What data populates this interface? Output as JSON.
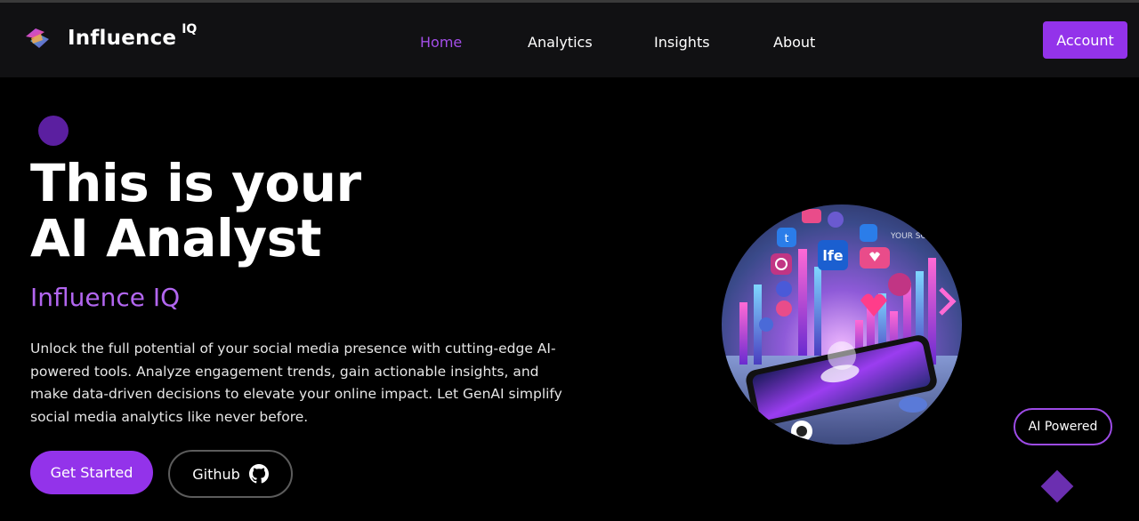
{
  "brand": {
    "name": "Influence",
    "sup": "IQ",
    "accent": "#9333ea"
  },
  "nav": {
    "items": [
      {
        "label": "Home",
        "active": true
      },
      {
        "label": "Analytics",
        "active": false
      },
      {
        "label": "Insights",
        "active": false
      },
      {
        "label": "About",
        "active": false
      }
    ],
    "account_label": "Account"
  },
  "hero": {
    "headline_line1": "This is your",
    "headline_line2": "AI Analyst",
    "subhead": "Influence IQ",
    "description": "Unlock the full potential of your social media presence with cutting-edge AI-powered tools. Analyze engagement trends, gain actionable insights, and make data-driven decisions to elevate your online impact. Let GenAI simplify social media analytics like never before.",
    "primary_cta": "Get Started",
    "secondary_cta": "Github",
    "badge": "AI Powered",
    "image_text": {
      "app": "lfe",
      "top_right": "YOUR SOCI"
    }
  }
}
